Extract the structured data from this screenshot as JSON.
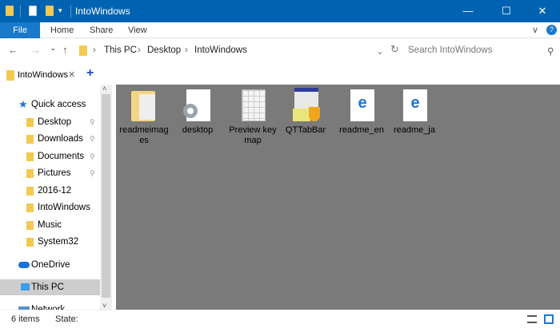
{
  "window": {
    "title": "IntoWindows",
    "minimize": "—",
    "maximize": "☐",
    "close": "✕"
  },
  "ribbon": {
    "tabs": [
      "File",
      "Home",
      "Share",
      "View"
    ],
    "help": "?",
    "collapse": "∨"
  },
  "address": {
    "back": "←",
    "forward": "→",
    "recent": "⌄",
    "up": "↑",
    "crumbs": [
      "This PC",
      "Desktop",
      "IntoWindows"
    ],
    "sep": "›",
    "refresh": "↻",
    "dropdown": "⌄",
    "search_placeholder": "Search IntoWindows",
    "search_icon": "⚲"
  },
  "tabs": {
    "items": [
      {
        "label": "IntoWindows",
        "close": "✕"
      }
    ],
    "add": "+"
  },
  "sidebar": {
    "quick_access": "Quick access",
    "items": [
      {
        "label": "Desktop",
        "pinned": true
      },
      {
        "label": "Downloads",
        "pinned": true
      },
      {
        "label": "Documents",
        "pinned": true
      },
      {
        "label": "Pictures",
        "pinned": true
      },
      {
        "label": "2016-12",
        "pinned": false
      },
      {
        "label": "IntoWindows",
        "pinned": false
      },
      {
        "label": "Music",
        "pinned": false
      },
      {
        "label": "System32",
        "pinned": false
      }
    ],
    "onedrive": "OneDrive",
    "this_pc": "This PC",
    "network": "Network",
    "pin_icon": "📌"
  },
  "files": [
    {
      "name": "readmeimages",
      "icon": "folder-icon"
    },
    {
      "name": "desktop",
      "icon": "settings-file-icon"
    },
    {
      "name": "Preview key map",
      "icon": "image-file-icon"
    },
    {
      "name": "QTTabBar",
      "icon": "installer-icon"
    },
    {
      "name": "readme_en",
      "icon": "edge-html-icon"
    },
    {
      "name": "readme_ja",
      "icon": "edge-html-icon"
    }
  ],
  "status": {
    "count": "6 items",
    "state_label": "State:"
  },
  "colors": {
    "titlebar": "#0063b1",
    "file_tab": "#1979ca",
    "content_bg": "#7a7a7a",
    "selected": "#cce8ff"
  }
}
